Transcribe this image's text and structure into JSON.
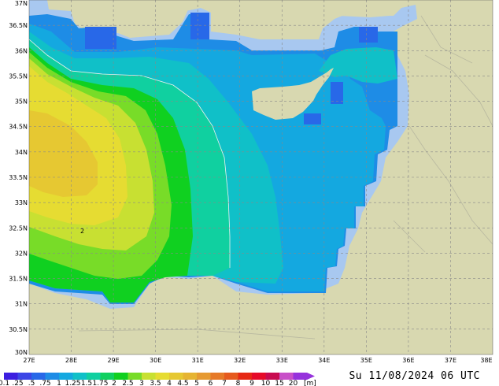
{
  "map": {
    "lat_labels": [
      "37N",
      "36.5N",
      "36N",
      "35.5N",
      "35N",
      "34.5N",
      "34N",
      "33.5N",
      "33N",
      "32.5N",
      "32N",
      "31.5N",
      "31N",
      "30.5N",
      "30N"
    ],
    "lon_labels": [
      "27E",
      "28E",
      "29E",
      "30E",
      "31E",
      "32E",
      "33E",
      "34E",
      "35E",
      "36E",
      "37E",
      "38E"
    ],
    "contour_label": "2",
    "colors": {
      "land": "#d8d8b0",
      "coast_shelf": "#a8c8f0",
      "grid": "#888888"
    }
  },
  "colorbar": {
    "labels": [
      "0.1",
      ".25",
      ".5",
      ".75",
      "1",
      "1.25",
      "1.5",
      "1.75",
      "2",
      "2.5",
      "3",
      "3.5",
      "4",
      "4.5",
      "5",
      "6",
      "7",
      "8",
      "9",
      "10",
      "15",
      "20"
    ],
    "unit": "[m]",
    "colors": [
      "#3c1ee0",
      "#3c46e6",
      "#2868e8",
      "#1e8ce6",
      "#14a8e0",
      "#10c0c8",
      "#10d0a0",
      "#10d060",
      "#10d020",
      "#78dc28",
      "#c8e032",
      "#e6dc32",
      "#e6c832",
      "#e6b432",
      "#e69a32",
      "#e67a28",
      "#e65a1e",
      "#e62814",
      "#e60a28",
      "#c80a50",
      "#c850c8",
      "#9632dc"
    ]
  },
  "valid_time": "Su 11/08/2024 06 UTC"
}
